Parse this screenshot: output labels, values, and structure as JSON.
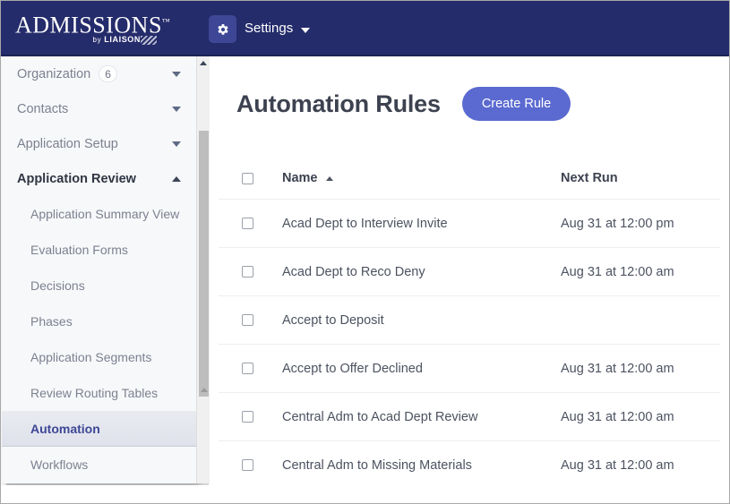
{
  "header": {
    "logo_main": "ADMISSIONS",
    "logo_tm": "™",
    "logo_by": "by",
    "logo_brand": "LIAISON",
    "gear_icon": "gear-icon",
    "settings_label": "Settings",
    "caret_icon": "caret-down-icon",
    "bg_color": "#252c6b"
  },
  "sidebar": {
    "groups": [
      {
        "label": "Organization",
        "badge": "6",
        "expanded": false,
        "chevron": "chevron-down-icon"
      },
      {
        "label": "Contacts",
        "badge": null,
        "expanded": false,
        "chevron": "chevron-down-icon"
      },
      {
        "label": "Application Setup",
        "badge": null,
        "expanded": false,
        "chevron": "chevron-down-icon"
      },
      {
        "label": "Application Review",
        "badge": null,
        "expanded": true,
        "chevron": "chevron-up-icon"
      }
    ],
    "items": [
      {
        "label": "Application Summary View",
        "active": false
      },
      {
        "label": "Evaluation Forms",
        "active": false
      },
      {
        "label": "Decisions",
        "active": false
      },
      {
        "label": "Phases",
        "active": false
      },
      {
        "label": "Application Segments",
        "active": false
      },
      {
        "label": "Review Routing Tables",
        "active": false
      },
      {
        "label": "Automation",
        "active": true
      },
      {
        "label": "Workflows",
        "active": false
      }
    ],
    "scrollbar": {
      "up_arrow": "scroll-up-arrow-icon",
      "thumb": "scroll-thumb"
    }
  },
  "main": {
    "title": "Automation Rules",
    "create_button": "Create Rule",
    "accent_color": "#5b6ad0",
    "table": {
      "columns": [
        {
          "key": "name",
          "label": "Name",
          "sort": "asc"
        },
        {
          "key": "next_run",
          "label": "Next Run",
          "sort": null
        }
      ],
      "select_all_checked": false,
      "rows": [
        {
          "name": "Acad Dept to Interview Invite",
          "next_run": "Aug 31 at 12:00 pm",
          "checked": false
        },
        {
          "name": "Acad Dept to Reco Deny",
          "next_run": "Aug 31 at 12:00 am",
          "checked": false
        },
        {
          "name": "Accept to Deposit",
          "next_run": "",
          "checked": false
        },
        {
          "name": "Accept to Offer Declined",
          "next_run": "Aug 31 at 12:00 am",
          "checked": false
        },
        {
          "name": "Central Adm to Acad Dept Review",
          "next_run": "Aug 31 at 12:00 am",
          "checked": false
        },
        {
          "name": "Central Adm to Missing Materials",
          "next_run": "Aug 31 at 12:00 am",
          "checked": false
        }
      ]
    }
  }
}
